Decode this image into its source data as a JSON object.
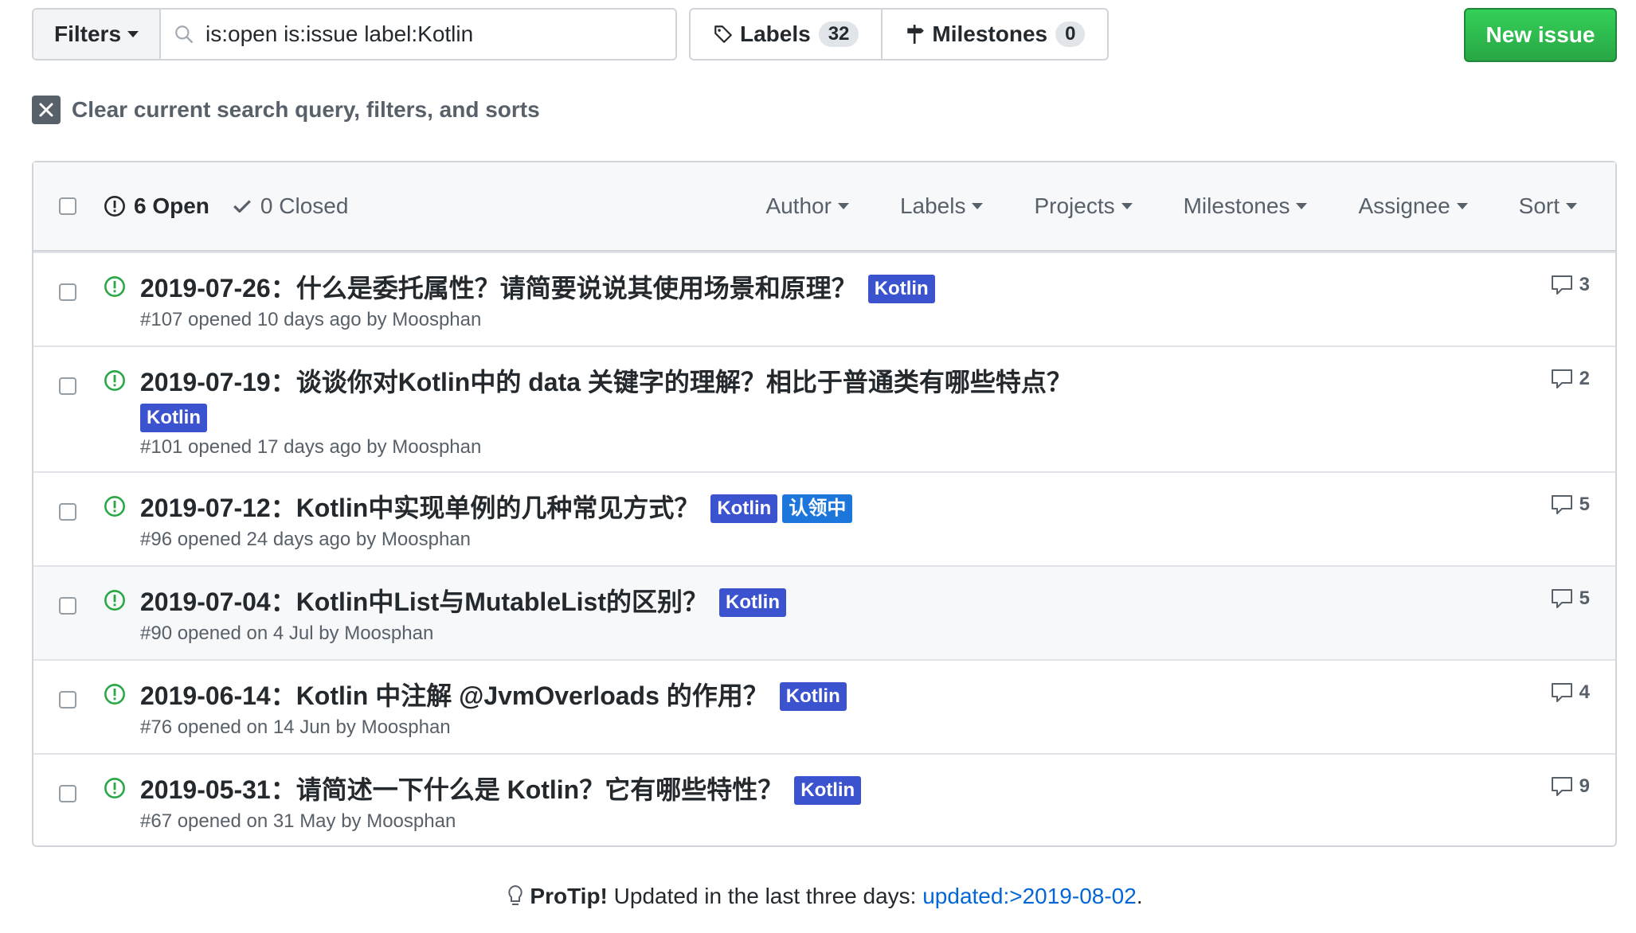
{
  "toolbar": {
    "filters_label": "Filters",
    "search_value": "is:open is:issue label:Kotlin",
    "labels_label": "Labels",
    "labels_count": "32",
    "milestones_label": "Milestones",
    "milestones_count": "0",
    "new_issue_label": "New issue"
  },
  "clear_query_label": "Clear current search query, filters, and sorts",
  "list_header": {
    "open_label": "6 Open",
    "closed_label": "0 Closed",
    "filters": [
      "Author",
      "Labels",
      "Projects",
      "Milestones",
      "Assignee",
      "Sort"
    ]
  },
  "issues": [
    {
      "title": "2019-07-26：什么是委托属性？请简要说说其使用场景和原理？",
      "labels": [
        "Kotlin"
      ],
      "meta": "#107 opened 10 days ago by Moosphan",
      "comments": "3"
    },
    {
      "title": "2019-07-19：谈谈你对Kotlin中的 data 关键字的理解？相比于普通类有哪些特点？",
      "labels": [
        "Kotlin"
      ],
      "meta": "#101 opened 17 days ago by Moosphan",
      "comments": "2"
    },
    {
      "title": "2019-07-12：Kotlin中实现单例的几种常见方式？",
      "labels": [
        "Kotlin",
        "认领中"
      ],
      "meta": "#96 opened 24 days ago by Moosphan",
      "comments": "5"
    },
    {
      "title": "2019-07-04：Kotlin中List与MutableList的区别？",
      "labels": [
        "Kotlin"
      ],
      "meta": "#90 opened on 4 Jul by Moosphan",
      "comments": "5"
    },
    {
      "title": "2019-06-14：Kotlin 中注解 @JvmOverloads 的作用？",
      "labels": [
        "Kotlin"
      ],
      "meta": "#76 opened on 14 Jun by Moosphan",
      "comments": "4"
    },
    {
      "title": "2019-05-31：请简述一下什么是 Kotlin？它有哪些特性？",
      "labels": [
        "Kotlin"
      ],
      "meta": "#67 opened on 31 May by Moosphan",
      "comments": "9"
    }
  ],
  "protip": {
    "strong": "ProTip!",
    "text": " Updated in the last three days: ",
    "link": "updated:>2019-08-02",
    "tail": "."
  },
  "colors": {
    "accent_green": "#28a745",
    "label_blue": "#3c53d0",
    "label_blue2": "#1d76db",
    "link": "#0366d6"
  }
}
